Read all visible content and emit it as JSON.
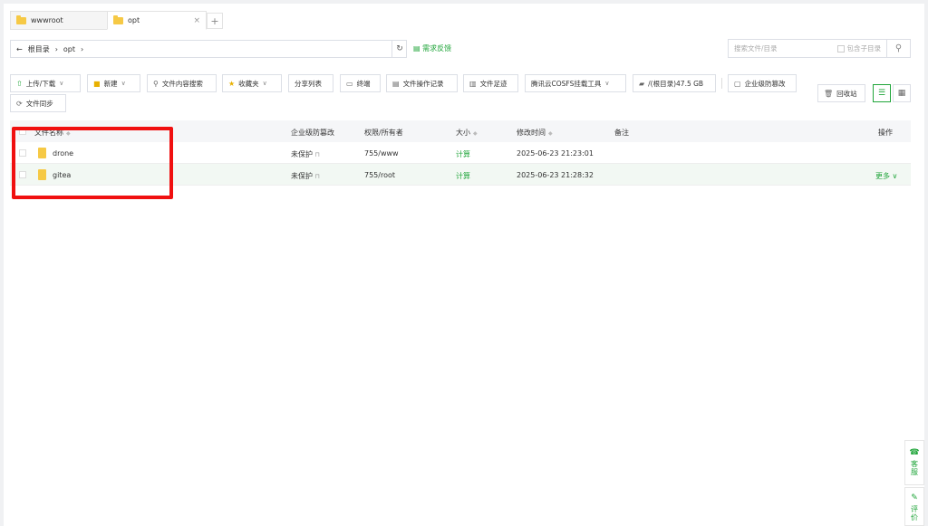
{
  "tabs": [
    {
      "label": "wwwroot"
    },
    {
      "label": "opt",
      "close": "×"
    }
  ],
  "add_tab": "+",
  "address": {
    "back": "←",
    "root": "根目录",
    "sep1": "›",
    "folder": "opt",
    "sep2": "›",
    "refresh": "↻"
  },
  "feedback": "需求反馈",
  "search": {
    "placeholder": "搜索文件/目录",
    "include_sub": "包含子目录",
    "icon": "search-icon"
  },
  "toolbar": {
    "upload": "上传/下载",
    "new": "新建",
    "content_search": "文件内容搜索",
    "favorites": "收藏夹",
    "share_list": "分享列表",
    "terminal": "终端",
    "op_log": "文件操作记录",
    "footprint": "文件足迹",
    "cosfs": "腾讯云COSFS挂载工具",
    "disk": "/(根目录)47.5 GB",
    "tamper": "企业级防篡改",
    "sync": "文件同步",
    "recycle": "回收站"
  },
  "table": {
    "headers": {
      "name": "文件名称",
      "tamper": "企业级防篡改",
      "perm": "权限/所有者",
      "size": "大小",
      "mtime": "修改时间",
      "note": "备注",
      "ops": "操作"
    },
    "rows": [
      {
        "name": "drone",
        "tamper": "未保护",
        "perm": "755/www",
        "size": "计算",
        "mtime": "2025-06-23 21:23:01",
        "note": "",
        "ops": ""
      },
      {
        "name": "gitea",
        "tamper": "未保护",
        "perm": "755/root",
        "size": "计算",
        "mtime": "2025-06-23 21:28:32",
        "note": "",
        "ops": "更多"
      }
    ]
  },
  "side": {
    "service": [
      "客",
      "服"
    ],
    "review": [
      "评",
      "价"
    ]
  },
  "colors": {
    "accent": "#20a53a",
    "highlight_box": "#f01010",
    "folder": "#f6c945"
  }
}
